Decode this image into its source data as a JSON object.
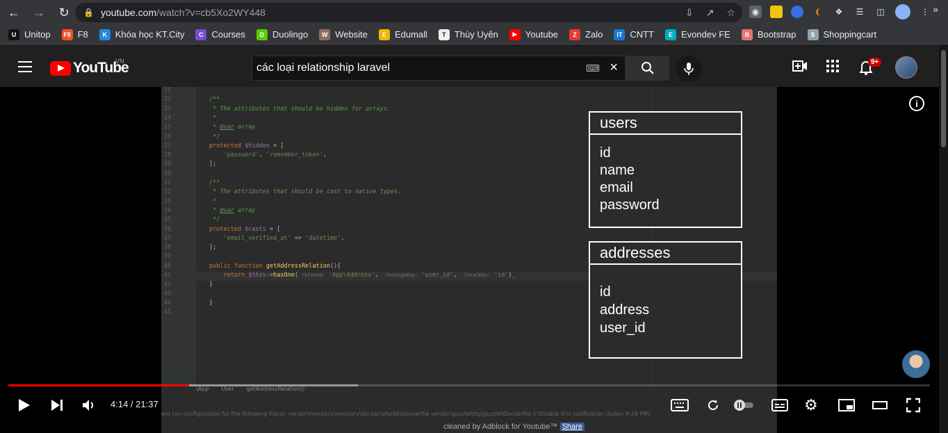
{
  "browser": {
    "url_host": "youtube.com",
    "url_path": "/watch?v=cb5Xo2WY448"
  },
  "bookmarks": [
    {
      "label": "Unitop",
      "color": "#111111",
      "glyph": "U"
    },
    {
      "label": "F8",
      "color": "#f05123",
      "glyph": "F8"
    },
    {
      "label": "Khóa học KT.City",
      "color": "#1e88e5",
      "glyph": "K"
    },
    {
      "label": "Courses",
      "color": "#7b4bd6",
      "glyph": "C"
    },
    {
      "label": "Duolingo",
      "color": "#58cc02",
      "glyph": "D"
    },
    {
      "label": "Website",
      "color": "#8d6e63",
      "glyph": "W"
    },
    {
      "label": "Edumall",
      "color": "#f4b400",
      "glyph": "E"
    },
    {
      "label": "Thùy Uyên",
      "color": "#eeeeee",
      "glyph": "T"
    },
    {
      "label": "Youtube",
      "color": "#ff0000",
      "glyph": "▶"
    },
    {
      "label": "Zalo",
      "color": "#e53935",
      "glyph": "Z"
    },
    {
      "label": "CNTT",
      "color": "#1976d2",
      "glyph": "IT"
    },
    {
      "label": "Evondev FE",
      "color": "#00acc1",
      "glyph": "E"
    },
    {
      "label": "Bootstrap",
      "color": "#e57373",
      "glyph": "B"
    },
    {
      "label": "Shoppingcart",
      "color": "#90a4ae",
      "glyph": "S"
    }
  ],
  "youtube": {
    "logo_text": "YouTube",
    "country": "VN",
    "search_query": "các loại relationship laravel",
    "notification_count": "9+"
  },
  "video": {
    "tables": {
      "users": {
        "name": "users",
        "fields": [
          "id",
          "name",
          "email",
          "password"
        ]
      },
      "addresses": {
        "name": "addresses",
        "fields": [
          "id",
          "address",
          "user_id"
        ]
      }
    },
    "ide_breadcrumb": [
      "\\App",
      "User",
      "getAddressRelation()"
    ],
    "ide_notice": "ent run configuration for the following file(s): vendor\\mockery\\mockery\\docker\\php56\\Dockerfile vendor\\guzzlehttp\\guzzle\\Dockerfile // Disable this notification (today 9:26 PM)",
    "code_lines": [
      {
        "n": "21",
        "html": ""
      },
      {
        "n": "22",
        "html": "<span class='cmt'>/**</span>"
      },
      {
        "n": "23",
        "html": "<span class='cmt'> * The attributes that should be hidden for arrays.</span>"
      },
      {
        "n": "24",
        "html": "<span class='cmt'> *</span>"
      },
      {
        "n": "25",
        "html": "<span class='cmt'> * <u>@var</u> array</span>"
      },
      {
        "n": "26",
        "html": "<span class='cmt'> */</span>"
      },
      {
        "n": "27",
        "html": "<span class='kw'>protected</span> <span class='var'>$hidden</span> = ["
      },
      {
        "n": "28",
        "html": "    <span class='str'>'password'</span>, <span class='str'>'remember_token'</span>,"
      },
      {
        "n": "29",
        "html": "];"
      },
      {
        "n": "30",
        "html": ""
      },
      {
        "n": "31",
        "html": "<span class='cmt'>/**</span>"
      },
      {
        "n": "32",
        "html": "<span class='cmt'> * The attributes that should be cast to native types.</span>"
      },
      {
        "n": "33",
        "html": "<span class='cmt'> *</span>"
      },
      {
        "n": "34",
        "html": "<span class='cmt'> * <u>@var</u> array</span>"
      },
      {
        "n": "35",
        "html": "<span class='cmt'> */</span>"
      },
      {
        "n": "36",
        "html": "<span class='kw'>protected</span> <span class='var'>$casts</span> = ["
      },
      {
        "n": "37",
        "html": "    <span class='str'>'email_verified_at'</span> => <span class='str'>'datetime'</span>,"
      },
      {
        "n": "38",
        "html": "];"
      },
      {
        "n": "39",
        "html": ""
      },
      {
        "n": "40",
        "html": "<span class='kw'>public function</span> <span class='fn'>getAddressRelation</span>(){"
      },
      {
        "n": "41",
        "html": "    <span class='kw'>return</span> <span class='var'>$this</span>-><span class='fn'>hasOne</span>( <span class='hint'>related:</span> <span class='str'>'App\\Address'</span>,  <span class='hint'>foreignKey:</span> <span class='str'>'user_id'</span>,  <span class='hint'>localKey:</span> <span class='str'>'id'</span>)<span class='kw'>_</span>"
      },
      {
        "n": "42",
        "html": "}"
      },
      {
        "n": "43",
        "html": ""
      },
      {
        "n": "44",
        "html": "}"
      },
      {
        "n": "45",
        "html": ""
      }
    ]
  },
  "player": {
    "current_time": "4:14",
    "duration": "21:37",
    "time_display": "4:14 / 21:37",
    "progress_played_fraction": 0.196,
    "progress_loaded_fraction": 0.379,
    "adblock_text": "cleaned by Adblock for Youtube™",
    "share_label": "Share"
  }
}
